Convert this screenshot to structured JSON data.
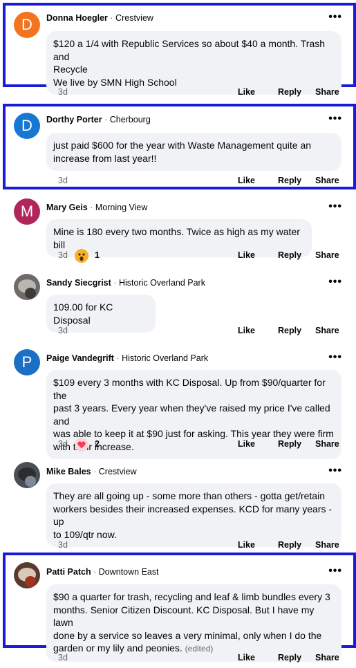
{
  "comments": [
    {
      "name": "Donna Hoegler",
      "location": "Crestview",
      "avatar_letter": "D",
      "avatar_color": "#f4731f",
      "lines": [
        "$120 a 1/4 with Republic Services so about $40 a month.  Trash and",
        "Recycle",
        "We live by SMN High School"
      ],
      "time": "3d",
      "like": "Like",
      "reply": "Reply",
      "share": "Share"
    },
    {
      "name": "Dorthy Porter",
      "location": "Cherbourg",
      "avatar_letter": "D",
      "avatar_color": "#1877d2",
      "lines": [
        "just paid $600 for the year with Waste Management quite an",
        "increase from last year!!"
      ],
      "time": "3d",
      "like": "Like",
      "reply": "Reply",
      "share": "Share"
    },
    {
      "name": "Mary Geis",
      "location": "Morning View",
      "avatar_letter": "M",
      "avatar_color": "#b2255a",
      "lines": [
        "Mine is 180 every two months. Twice as high as my water bill"
      ],
      "time": "3d",
      "reaction": "wow",
      "reaction_count": "1",
      "like": "Like",
      "reply": "Reply",
      "share": "Share"
    },
    {
      "name": "Sandy Siecgrist",
      "location": "Historic Overland Park",
      "lines": [
        "109.00 for KC Disposal"
      ],
      "time": "3d",
      "like": "Like",
      "reply": "Reply",
      "share": "Share"
    },
    {
      "name": "Paige Vandegrift",
      "location": "Historic Overland Park",
      "avatar_letter": "P",
      "avatar_color": "#1b6fc4",
      "lines": [
        "$109 every 3 months with KC Disposal.  Up from $90/quarter for the",
        "past 3 years.  Every year when they've raised my price I've called and",
        "was able to keep it at $90 just for asking.  This year they were firm",
        "with their increase."
      ],
      "time": "3d",
      "reaction": "love",
      "reaction_count": "2",
      "like": "Like",
      "reply": "Reply",
      "share": "Share"
    },
    {
      "name": "Mike Bales",
      "location": "Crestview",
      "lines": [
        "They are all going up - some more than others - gotta get/retain",
        "workers besides their increased expenses. KCD for many years - up",
        "to 109/qtr now."
      ],
      "time": "3d",
      "like": "Like",
      "reply": "Reply",
      "share": "Share"
    },
    {
      "name": "Patti Patch",
      "location": "Downtown East",
      "lines": [
        "$90 a quarter for trash, recycling and leaf & limb bundles every 3",
        "months. Senior Citizen Discount. KC Disposal. But I have my lawn",
        "done by a service so leaves a very minimal, only when I do the",
        "garden or my lily and peonies."
      ],
      "edited": "(edited)",
      "time": "3d",
      "like": "Like",
      "reply": "Reply",
      "share": "Share"
    }
  ],
  "colors": {
    "highlight": "#1a1adb",
    "bubble": "#f0f2f5",
    "muted": "#65676b"
  },
  "icons": {
    "more": "more-options-icon",
    "wow": "wow-reaction-icon",
    "love": "love-reaction-icon"
  },
  "separator": "·",
  "more_glyph": "•••"
}
